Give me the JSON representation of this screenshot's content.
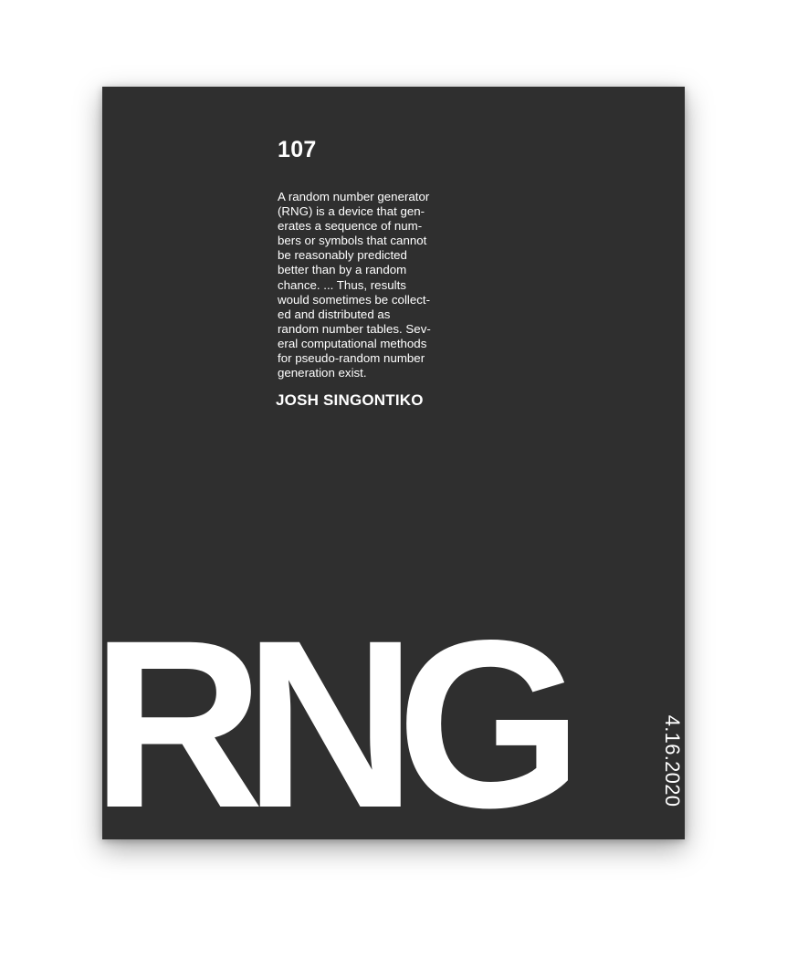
{
  "poster": {
    "issue_number": "107",
    "body_text": "A random number generator\n(RNG) is a device that gen-\nerates a sequence of num-\nbers or symbols that cannot\nbe reasonably predicted\nbetter than by a random\nchance. ... Thus, results\nwould sometimes be collect-\ned and distributed as\nrandom number tables. Sev-\neral computational methods\nfor pseudo-random number\ngeneration exist.",
    "author": "JOSH SINGONTIKO",
    "title": "RNG",
    "date": "4.16.2020",
    "colors": {
      "background": "#2f2f2f",
      "text": "#ffffff",
      "page": "#ffffff"
    }
  }
}
